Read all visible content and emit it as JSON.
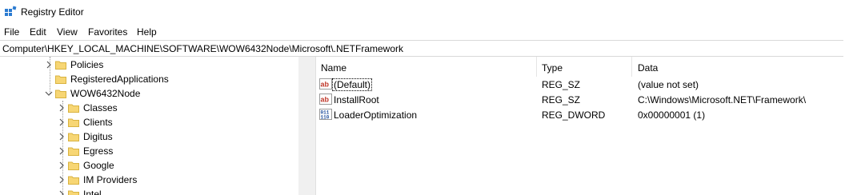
{
  "window": {
    "title": "Registry Editor"
  },
  "menu": {
    "items": [
      "File",
      "Edit",
      "View",
      "Favorites",
      "Help"
    ]
  },
  "address": {
    "path": "Computer\\HKEY_LOCAL_MACHINE\\SOFTWARE\\WOW6432Node\\Microsoft\\.NETFramework"
  },
  "tree": {
    "items": [
      {
        "label": "Policies",
        "chevron": "right"
      },
      {
        "label": "RegisteredApplications",
        "chevron": "none"
      },
      {
        "label": "WOW6432Node",
        "chevron": "down"
      },
      {
        "label": "Classes",
        "chevron": "right"
      },
      {
        "label": "Clients",
        "chevron": "right"
      },
      {
        "label": "Digitus",
        "chevron": "right"
      },
      {
        "label": "Egress",
        "chevron": "right"
      },
      {
        "label": "Google",
        "chevron": "right"
      },
      {
        "label": "IM Providers",
        "chevron": "right"
      },
      {
        "label": "Intel",
        "chevron": "right"
      }
    ]
  },
  "list": {
    "columns": {
      "name": "Name",
      "type": "Type",
      "data": "Data"
    },
    "rows": [
      {
        "name": "(Default)",
        "type": "REG_SZ",
        "data": "(value not set)",
        "icon": "string-value-icon"
      },
      {
        "name": "InstallRoot",
        "type": "REG_SZ",
        "data": "C:\\Windows\\Microsoft.NET\\Framework\\",
        "icon": "string-value-icon"
      },
      {
        "name": "LoaderOptimization",
        "type": "REG_DWORD",
        "data": "0x00000001 (1)",
        "icon": "binary-value-icon"
      }
    ]
  },
  "colors": {
    "folder": "#f7d674",
    "folder_edge": "#d9b340",
    "string_icon": "#c0392b",
    "binary_icon": "#1f4e9c"
  }
}
